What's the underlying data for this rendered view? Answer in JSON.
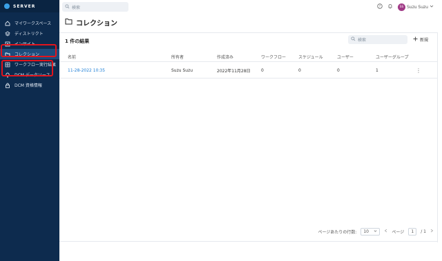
{
  "brand": {
    "name": "SERVER"
  },
  "sidebar": {
    "items": [
      {
        "label": "マイワークスペース",
        "icon": "home-icon"
      },
      {
        "label": "ディストリクト",
        "icon": "district-icon"
      },
      {
        "label": "インサイト",
        "icon": "insight-icon"
      },
      {
        "label": "コレクション",
        "icon": "folder-icon",
        "active": true
      },
      {
        "label": "ワークフロー実行結果",
        "icon": "results-icon"
      },
      {
        "label": "DCM データソース",
        "icon": "bulb-icon"
      },
      {
        "label": "DCM 資格情報",
        "icon": "lock-icon"
      }
    ]
  },
  "topbar": {
    "search_placeholder": "検索",
    "user_initials": "SS",
    "user_name": "Suzu Suzu"
  },
  "page": {
    "title": "コレクション",
    "results": "1 件の結果",
    "filter_placeholder": "検索",
    "new_label": "新規"
  },
  "table": {
    "headers": [
      "名前",
      "所有者",
      "作成済み",
      "ワークフロー",
      "スケジュール",
      "ユーザー",
      "ユーザーグループ"
    ],
    "rows": [
      {
        "name": "11-28-2022 10:35",
        "owner": "Suzu Suzu",
        "created": "2022年11月28日",
        "workflows": "0",
        "schedules": "0",
        "users": "0",
        "usergroups": "1"
      }
    ]
  },
  "pager": {
    "rows_label": "ページあたりの行数:",
    "rows_value": "10",
    "page_label": "ページ",
    "page_value": "1",
    "page_total": "/ 1"
  },
  "colors": {
    "sidebar": "#0d2b4e",
    "accent": "#1c7ed6",
    "highlight": "#e3141c"
  }
}
